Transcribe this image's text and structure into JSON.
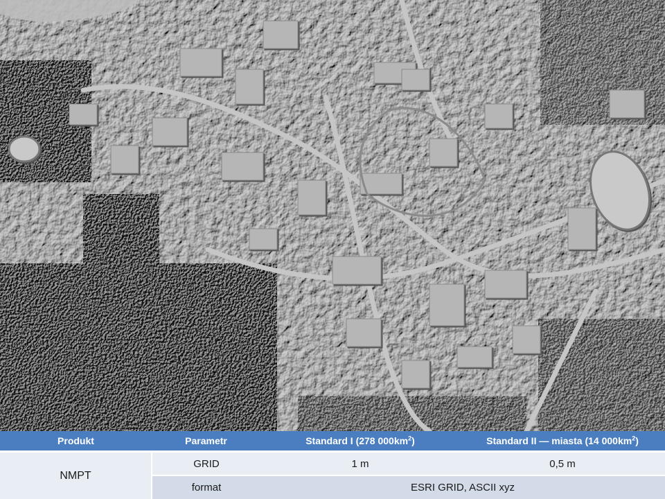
{
  "map": {
    "description_icon": "hillshade-relief-map"
  },
  "table": {
    "headers": {
      "product": "Produkt",
      "parameter": "Parametr",
      "standard1_pre": "Standard I (278 000km",
      "standard1_sup": "2",
      "standard1_post": ")",
      "standard2_pre": "Standard II — miasta (14 000km",
      "standard2_sup": "2",
      "standard2_post": ")"
    },
    "product": "NMPT",
    "rows": [
      {
        "parameter": "GRID",
        "standard1": "1 m",
        "standard2": "0,5 m"
      },
      {
        "parameter": "format",
        "both": "ESRI GRID, ASCII xyz"
      }
    ]
  },
  "colors": {
    "header_bg": "#4a7ec0",
    "row1_bg": "#e9edf4",
    "row2_bg": "#d3dbe8"
  }
}
